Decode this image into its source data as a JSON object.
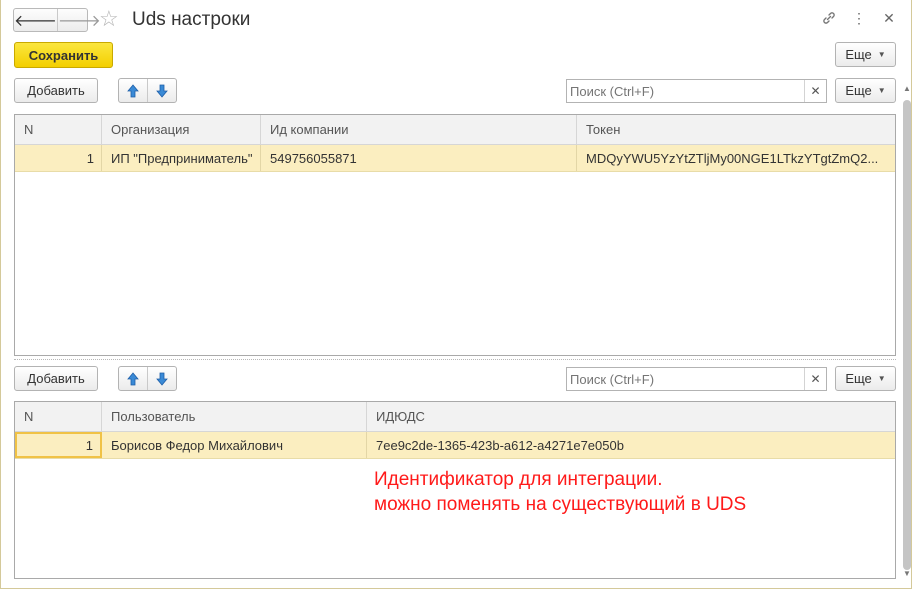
{
  "window": {
    "title": "Uds настроки"
  },
  "nav": {
    "back": "🡐",
    "forward": "🡒"
  },
  "toolbar": {
    "save_label": "Сохранить",
    "more_label": "Еще"
  },
  "upper": {
    "add_label": "Добавить",
    "search_placeholder": "Поиск (Ctrl+F)",
    "more_label": "Еще",
    "columns": [
      "N",
      "Организация",
      "Ид компании",
      "Токен"
    ],
    "rows": [
      {
        "n": "1",
        "org": "ИП \"Предприниматель\"",
        "company_id": "549756055871",
        "token": "MDQyYWU5YzYtZTljMy00NGE1LTkzYTgtZmQ2..."
      }
    ]
  },
  "lower": {
    "add_label": "Добавить",
    "search_placeholder": "Поиск (Ctrl+F)",
    "more_label": "Еще",
    "columns": [
      "N",
      "Пользователь",
      "ИДЮДС"
    ],
    "rows": [
      {
        "n": "1",
        "user": "Борисов Федор Михайлович",
        "uds_id": "7ee9c2de-1365-423b-a612-a4271e7e050b"
      }
    ]
  },
  "annotation": {
    "line1": "Идентификатор для интеграции.",
    "line2": "можно поменять на существующий в UDS"
  },
  "colors": {
    "save_button": "#f7d80f",
    "selected_row": "#fbeec0",
    "annotation": "#ff1a1a"
  }
}
